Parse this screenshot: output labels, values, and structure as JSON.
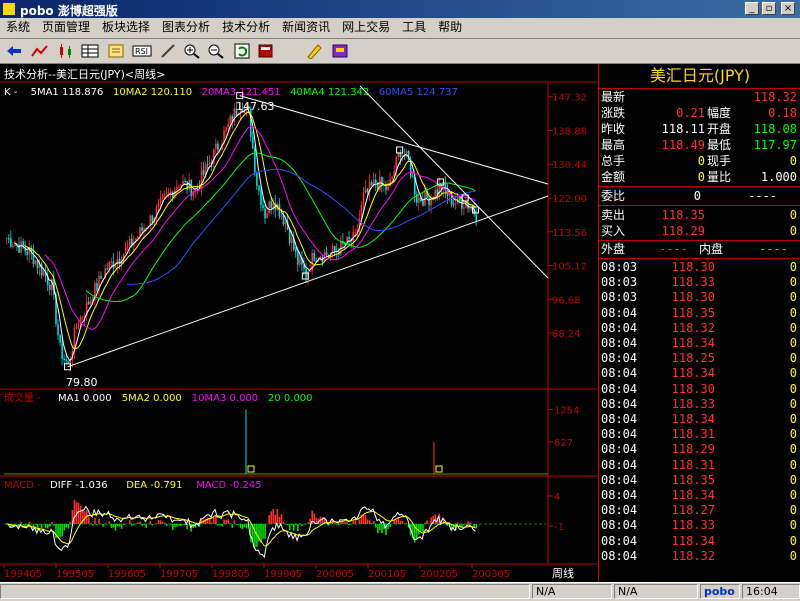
{
  "window": {
    "title": "pobo 澎博超强版",
    "min": "_",
    "restore": "▫",
    "close": "×"
  },
  "menu": [
    "系统",
    "页面管理",
    "板块选择",
    "图表分析",
    "技术分析",
    "新闻资讯",
    "网上交易",
    "工具",
    "帮助"
  ],
  "toolbar_icons": [
    "back-arrow-icon",
    "line-chart-icon",
    "candlestick-icon",
    "table-icon",
    "notebook-icon",
    "rsi-icon",
    "pencil-icon",
    "zoom-in-icon",
    "zoom-out-icon",
    "refresh-icon",
    "book-icon",
    "marker-icon",
    "purple-book-icon"
  ],
  "chart": {
    "title": "技术分析--美汇日元(JPY)<周线>",
    "ma_legend": [
      {
        "label": "K",
        "color": "#ffffff"
      },
      {
        "label": "5MA1",
        "value": "118.876",
        "color": "#ffffff"
      },
      {
        "label": "10MA2",
        "value": "120.110",
        "color": "#ffff00"
      },
      {
        "label": "20MA3",
        "value": "121.451",
        "color": "#ff00ff"
      },
      {
        "label": "40MA4",
        "value": "121.342",
        "color": "#00ff00"
      },
      {
        "label": "60MA5",
        "value": "124.737",
        "color": "#3050ff"
      }
    ],
    "price_axis": [
      "147.32",
      "138.88",
      "130.44",
      "122.00",
      "113.56",
      "105.12",
      "96.68",
      "88.24"
    ],
    "annotations": {
      "high": "147.63",
      "low": "79.80"
    },
    "volume_legend": {
      "title": "成交量",
      "items": [
        {
          "label": "MA1",
          "value": "0.000",
          "color": "#ffffff"
        },
        {
          "label": "5MA2",
          "value": "0.000",
          "color": "#ffff00"
        },
        {
          "label": "10MA3",
          "value": "0.000",
          "color": "#ff00ff"
        },
        {
          "label": "20",
          "value": "0.000",
          "color": "#00ff00"
        }
      ]
    },
    "volume_axis": [
      "1254",
      "627"
    ],
    "macd_legend": {
      "title": "MACD",
      "items": [
        {
          "label": "DIFF",
          "value": "-1.036",
          "color": "#ffffff"
        },
        {
          "label": "DEA",
          "value": "-0.791",
          "color": "#ffff00"
        },
        {
          "label": "MACD",
          "value": "-0.245",
          "color": "#ff00ff"
        }
      ]
    },
    "macd_axis": [
      "4",
      "-1"
    ],
    "x_axis": [
      "199405",
      "199505",
      "199605",
      "199705",
      "199805",
      "199905",
      "200005",
      "200105",
      "200205",
      "200305"
    ],
    "period_label": "周线",
    "colors": {
      "up": "#ff3030",
      "down": "#00e0e0",
      "axis": "#c00000"
    }
  },
  "quote": {
    "title": "美汇日元(JPY)",
    "rows": [
      {
        "l": "最新",
        "v": "118.32",
        "vc": "#ff3030"
      },
      {
        "l": "涨跌",
        "v": "0.21",
        "vc": "#ff3030",
        "l2": "幅度",
        "v2": "0.18",
        "v2c": "#ff3030"
      },
      {
        "l": "昨收",
        "v": "118.11",
        "vc": "#ffffff",
        "l2": "开盘",
        "v2": "118.08",
        "v2c": "#00ff00"
      },
      {
        "l": "最高",
        "v": "118.49",
        "vc": "#ff3030",
        "l2": "最低",
        "v2": "117.97",
        "v2c": "#00ff00"
      },
      {
        "l": "总手",
        "v": "0",
        "vc": "#ffff00",
        "l2": "现手",
        "v2": "0",
        "v2c": "#ffff00"
      },
      {
        "l": "金额",
        "v": "0",
        "vc": "#ffff00",
        "l2": "量比",
        "v2": "1.000",
        "v2c": "#ffffff"
      }
    ],
    "weibi": {
      "l": "委比",
      "v": "0",
      "v2": "----"
    },
    "sell": {
      "l": "卖出",
      "v": "118.35",
      "v2": "0"
    },
    "buy": {
      "l": "买入",
      "v": "118.29",
      "v2": "0"
    },
    "outer": {
      "l": "外盘",
      "v": "----",
      "l2": "内盘",
      "v2": "----"
    },
    "ticks": [
      {
        "t": "08:03",
        "p": "118.30",
        "q": "0"
      },
      {
        "t": "08:03",
        "p": "118.33",
        "q": "0"
      },
      {
        "t": "08:03",
        "p": "118.30",
        "q": "0"
      },
      {
        "t": "08:04",
        "p": "118.35",
        "q": "0"
      },
      {
        "t": "08:04",
        "p": "118.32",
        "q": "0"
      },
      {
        "t": "08:04",
        "p": "118.34",
        "q": "0"
      },
      {
        "t": "08:04",
        "p": "118.25",
        "q": "0"
      },
      {
        "t": "08:04",
        "p": "118.34",
        "q": "0"
      },
      {
        "t": "08:04",
        "p": "118.30",
        "q": "0"
      },
      {
        "t": "08:04",
        "p": "118.33",
        "q": "0"
      },
      {
        "t": "08:04",
        "p": "118.34",
        "q": "0"
      },
      {
        "t": "08:04",
        "p": "118.31",
        "q": "0"
      },
      {
        "t": "08:04",
        "p": "118.29",
        "q": "0"
      },
      {
        "t": "08:04",
        "p": "118.31",
        "q": "0"
      },
      {
        "t": "08:04",
        "p": "118.35",
        "q": "0"
      },
      {
        "t": "08:04",
        "p": "118.34",
        "q": "0"
      },
      {
        "t": "08:04",
        "p": "118.27",
        "q": "0"
      },
      {
        "t": "08:04",
        "p": "118.33",
        "q": "0"
      },
      {
        "t": "08:04",
        "p": "118.34",
        "q": "0"
      },
      {
        "t": "08:04",
        "p": "118.32",
        "q": "0"
      }
    ]
  },
  "statusbar": {
    "na1": "N/A",
    "na2": "N/A",
    "brand": "pobo",
    "time": "16:04"
  }
}
